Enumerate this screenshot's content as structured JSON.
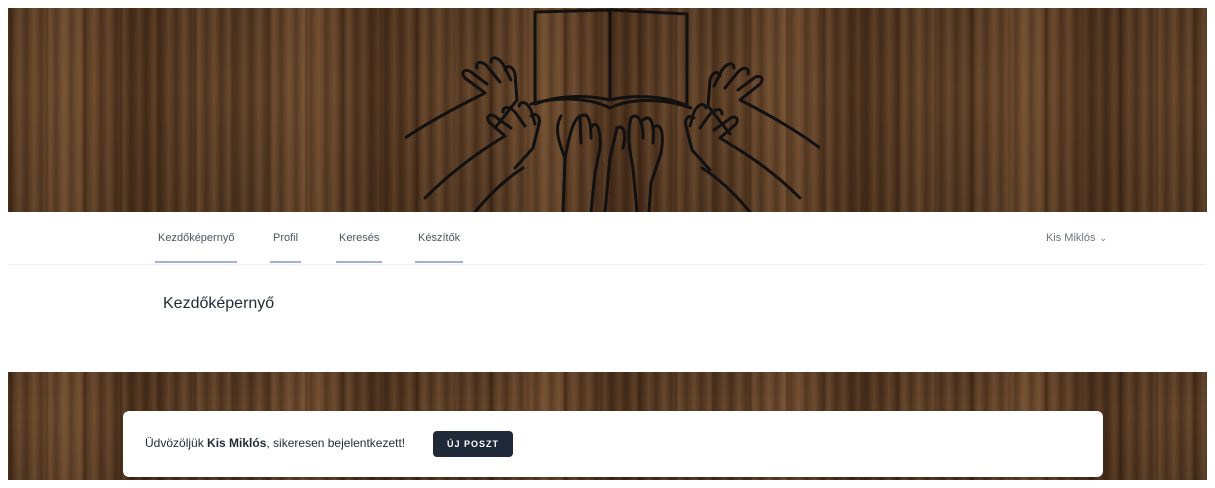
{
  "nav": {
    "items": [
      {
        "label": "Kezdőképernyő"
      },
      {
        "label": "Profil"
      },
      {
        "label": "Keresés"
      },
      {
        "label": "Készítők"
      }
    ],
    "user_name": "Kis Miklós"
  },
  "header": {
    "title": "Kezdőképernyő"
  },
  "welcome": {
    "prefix": "Üdvözöljük ",
    "name": "Kis Miklós",
    "suffix": ", sikeresen bejelentkezett!",
    "button_label": "ÚJ POSZT"
  },
  "colors": {
    "wood": "#5a3c24",
    "nav_underline": "#a5b0d8",
    "button_bg": "#1f2937"
  }
}
